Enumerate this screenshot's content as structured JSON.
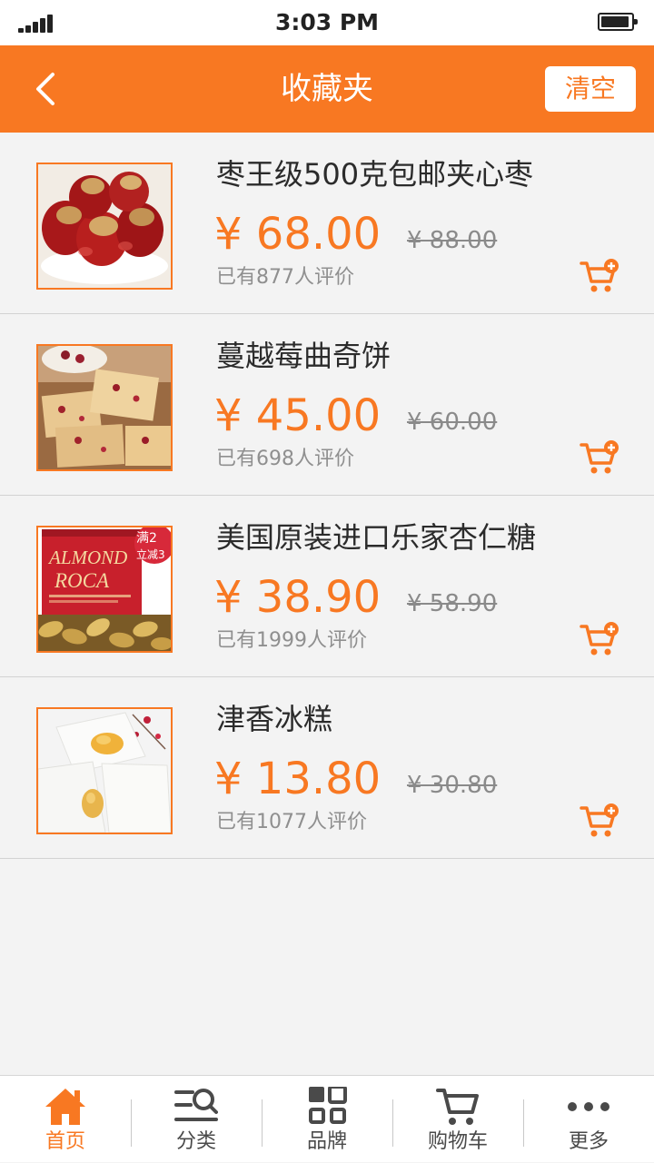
{
  "status_bar": {
    "time": "3:03 PM"
  },
  "header": {
    "title": "收藏夹",
    "clear_label": "清空"
  },
  "colors": {
    "accent": "#f87822",
    "price": "#f87822",
    "background": "#f3f3f3"
  },
  "items": [
    {
      "name": "枣王级500克包邮夹心枣",
      "price": "¥ 68.00",
      "original_price": "¥ 88.00",
      "reviews": "已有877人评价",
      "image_icon": "walnut-dates-image"
    },
    {
      "name": "蔓越莓曲奇饼",
      "price": "¥ 45.00",
      "original_price": "¥ 60.00",
      "reviews": "已有698人评价",
      "image_icon": "cranberry-cookie-image"
    },
    {
      "name": "美国原装进口乐家杏仁糖",
      "price": "¥ 38.90",
      "original_price": "¥ 58.90",
      "reviews": "已有1999人评价",
      "image_icon": "almond-roca-image",
      "image_text": {
        "brand_line1": "ALMOND",
        "brand_line2": "ROCA",
        "promo_line1": "满2",
        "promo_line2": "立减3"
      }
    },
    {
      "name": "津香冰糕",
      "price": "¥ 13.80",
      "original_price": "¥ 30.80",
      "reviews": "已有1077人评价",
      "image_icon": "ice-cake-image"
    }
  ],
  "tabbar": {
    "tabs": [
      {
        "label": "首页",
        "icon": "home-icon",
        "active": true
      },
      {
        "label": "分类",
        "icon": "category-search-icon",
        "active": false
      },
      {
        "label": "品牌",
        "icon": "grid-icon",
        "active": false
      },
      {
        "label": "购物车",
        "icon": "cart-icon",
        "active": false
      },
      {
        "label": "更多",
        "icon": "more-dots-icon",
        "active": false
      }
    ]
  }
}
